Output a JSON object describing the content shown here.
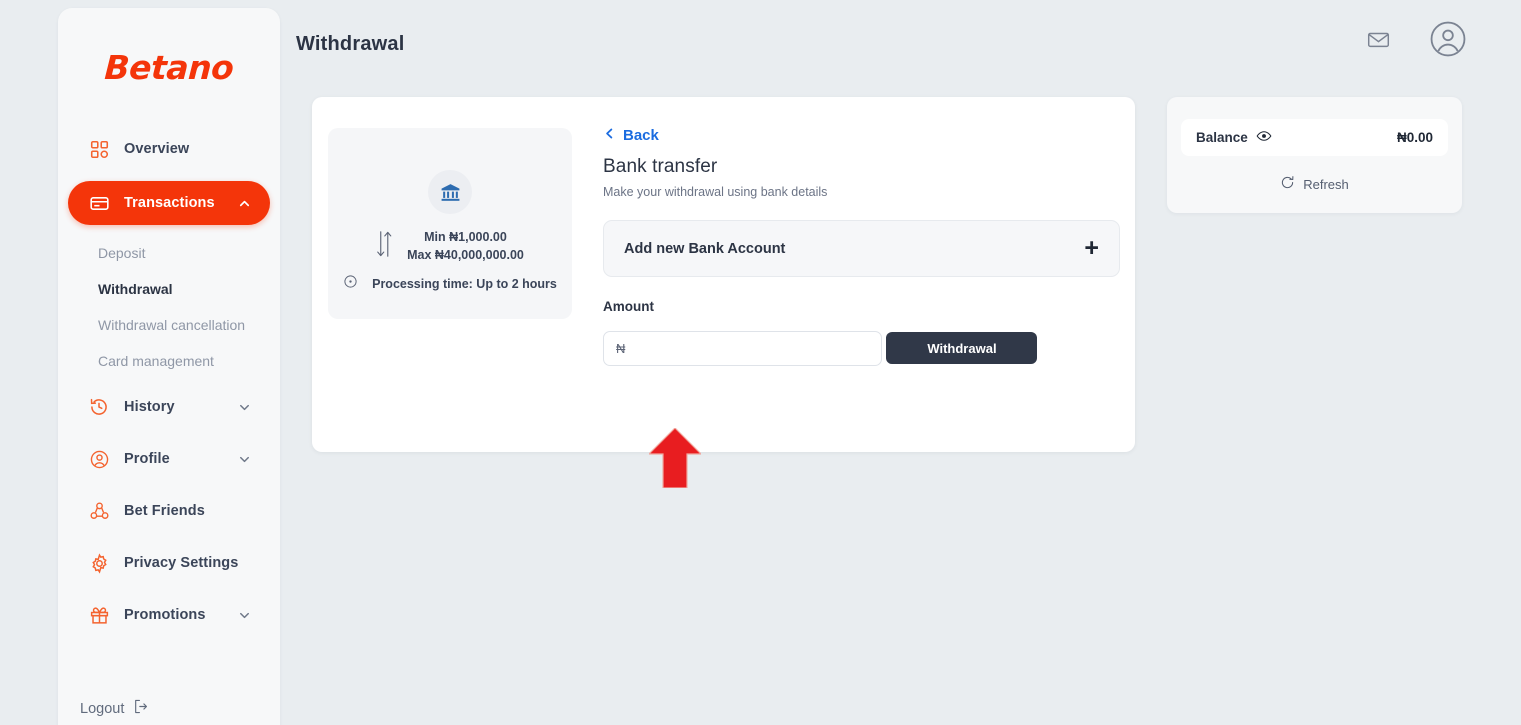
{
  "header": {
    "title": "Withdrawal",
    "mail_icon": "mail-icon",
    "account_icon": "account-circle-icon"
  },
  "sidebar": {
    "logo": "Betano",
    "items": [
      {
        "label": "Overview",
        "icon": "grid-icon",
        "expandable": false,
        "active": false
      },
      {
        "label": "Transactions",
        "icon": "card-icon",
        "expandable": true,
        "active": true,
        "chevron": "chevron-up-icon"
      },
      {
        "label": "History",
        "icon": "history-icon",
        "expandable": true,
        "active": false,
        "chevron": "chevron-down-icon"
      },
      {
        "label": "Profile",
        "icon": "profile-icon",
        "expandable": true,
        "active": false,
        "chevron": "chevron-down-icon"
      },
      {
        "label": "Bet Friends",
        "icon": "friends-icon",
        "expandable": false,
        "active": false
      },
      {
        "label": "Privacy Settings",
        "icon": "gear-icon",
        "expandable": false,
        "active": false
      },
      {
        "label": "Promotions",
        "icon": "gift-icon",
        "expandable": true,
        "active": false,
        "chevron": "chevron-down-icon"
      }
    ],
    "sub_items": [
      {
        "label": "Deposit",
        "current": false
      },
      {
        "label": "Withdrawal",
        "current": true
      },
      {
        "label": "Withdrawal cancellation",
        "current": false
      },
      {
        "label": "Card management",
        "current": false
      }
    ],
    "logout": {
      "label": "Logout",
      "icon": "logout-icon"
    }
  },
  "method": {
    "icon": "bank-icon",
    "limits_icon": "up-down-arrow-icon",
    "min": "Min ₦1,000.00",
    "max": "Max ₦40,000,000.00",
    "clock_icon": "clock-icon",
    "processing": "Processing time: Up to 2 hours"
  },
  "form": {
    "back_label": "Back",
    "back_icon": "chevron-left-icon",
    "title": "Bank transfer",
    "subtitle": "Make your withdrawal using bank details",
    "add_account_label": "Add new Bank Account",
    "add_account_icon": "plus-icon",
    "amount_label": "Amount",
    "amount_value": "",
    "amount_placeholder": "₦",
    "submit_label": "Withdrawal"
  },
  "balance": {
    "label": "Balance",
    "eye_icon": "eye-icon",
    "value": "₦0.00",
    "refresh_label": "Refresh",
    "refresh_icon": "refresh-icon"
  },
  "annotation": {
    "arrow": "red-up-arrow",
    "color": "#e81d20"
  },
  "colors": {
    "brand": "#f4350a",
    "accent_link": "#1b6ce0",
    "button_dark": "#303848",
    "page_bg": "#e9edf0"
  }
}
